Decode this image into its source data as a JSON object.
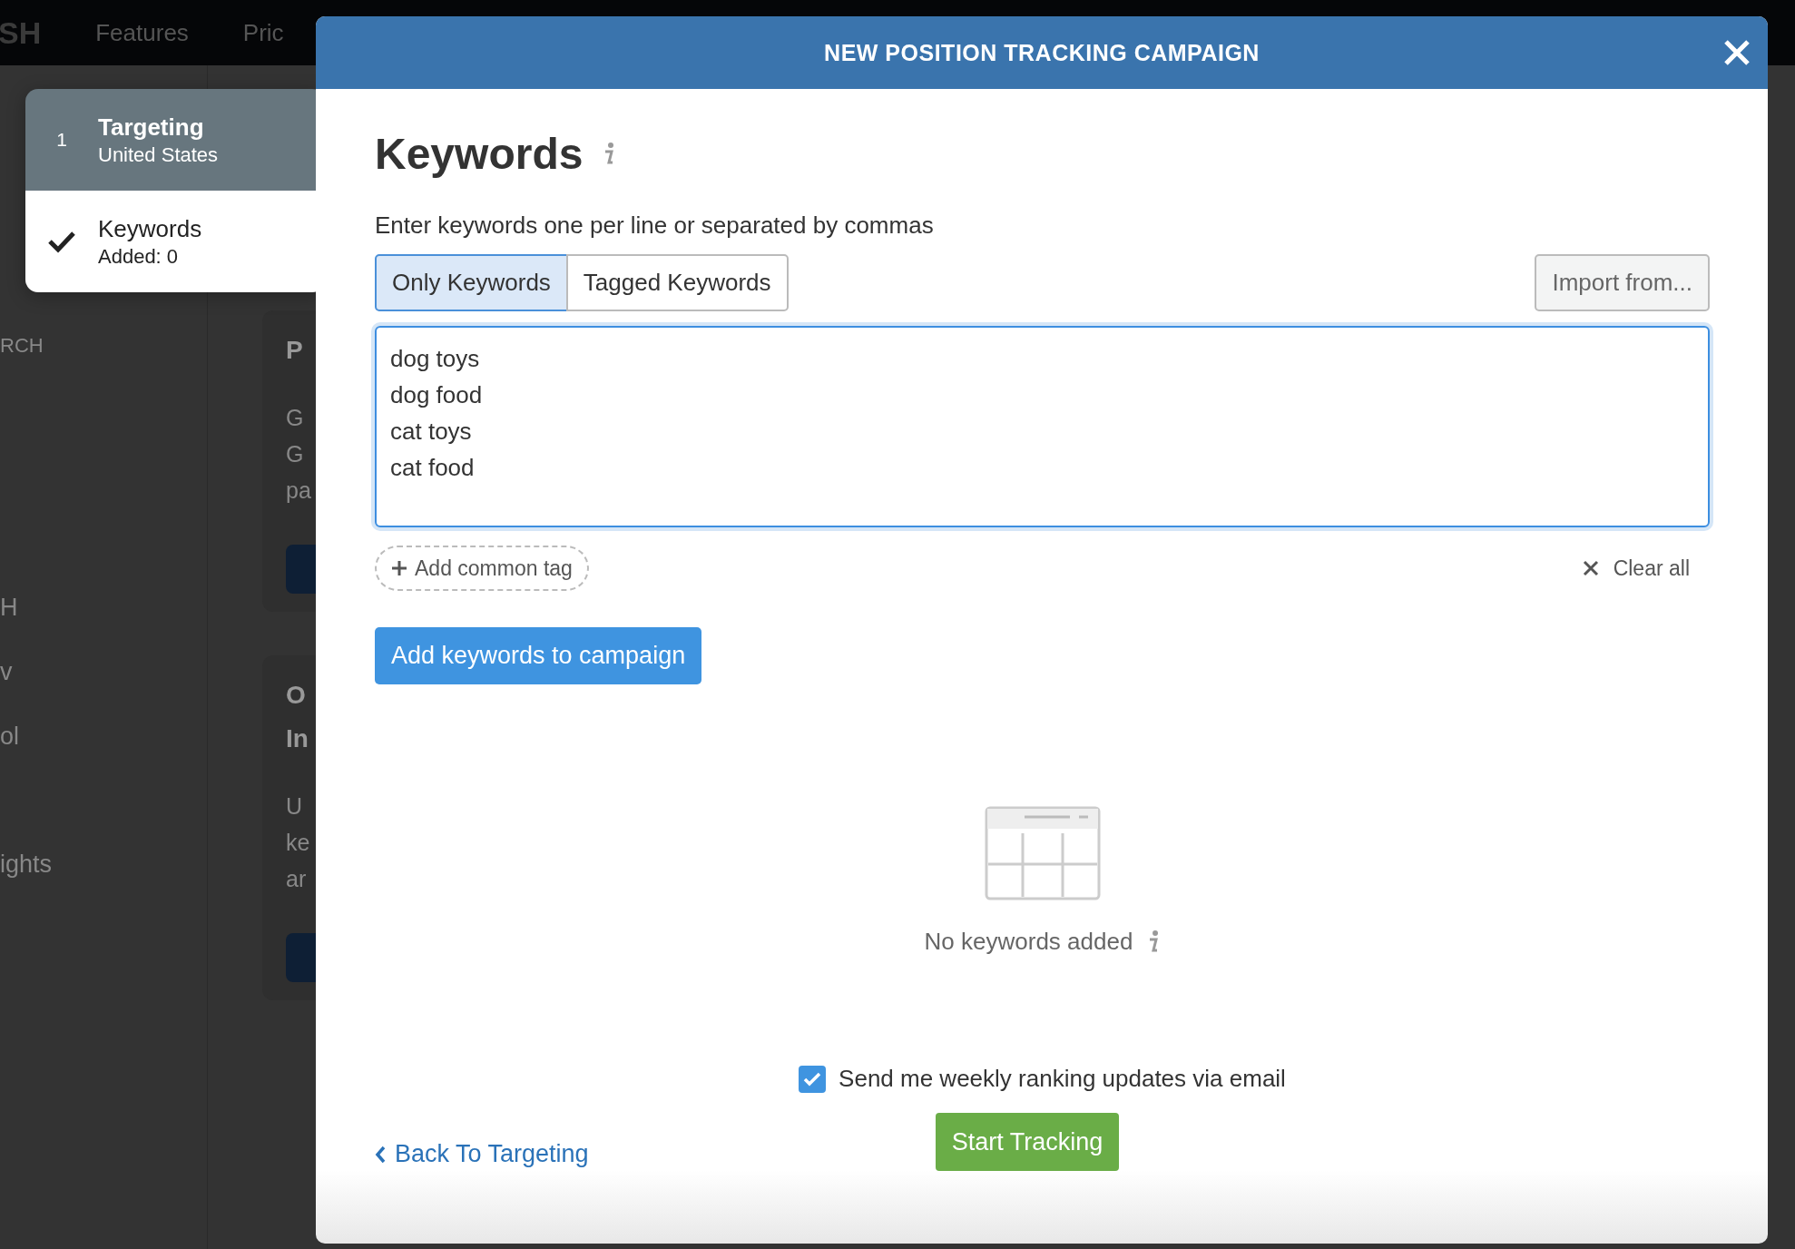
{
  "background": {
    "logo": "SH",
    "nav": [
      "Features",
      "Pric"
    ],
    "sidebar": [
      "RCH",
      "H",
      "v",
      "ol",
      "ights"
    ],
    "cards": [
      {
        "title": [
          "P"
        ],
        "body": [
          "G",
          "G",
          "pa"
        ]
      },
      {
        "title": [
          "O",
          "In"
        ],
        "body": [
          "U",
          "ke",
          "ar"
        ]
      }
    ]
  },
  "steps": [
    {
      "kind": "number",
      "marker": "1",
      "title": "Targeting",
      "subtitle": "United States",
      "selected": true
    },
    {
      "kind": "check",
      "title": "Keywords",
      "subtitle": "Added: 0",
      "selected": false
    }
  ],
  "modal": {
    "title": "NEW POSITION TRACKING CAMPAIGN",
    "heading": "Keywords",
    "instruction": "Enter keywords one per line or separated by commas",
    "tabs": [
      {
        "label": "Only Keywords",
        "selected": true
      },
      {
        "label": "Tagged Keywords",
        "selected": false
      }
    ],
    "import_button": "Import from...",
    "keywords_value": "dog toys\ndog food\ncat toys\ncat food",
    "add_tag": "Add common tag",
    "clear_all": "Clear all",
    "add_button": "Add keywords to campaign",
    "empty_text": "No keywords added",
    "email_option": {
      "label": "Send me weekly ranking updates via email",
      "checked": true
    },
    "back_link": "Back To Targeting",
    "start_button": "Start Tracking"
  }
}
